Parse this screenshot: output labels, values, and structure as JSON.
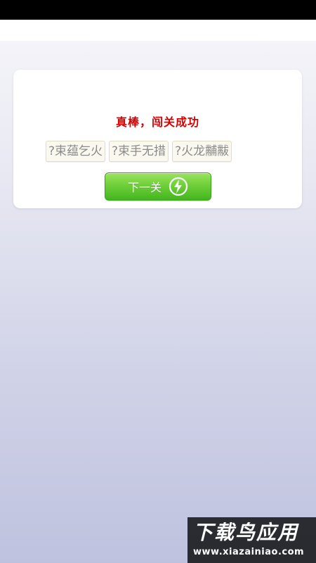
{
  "result": {
    "message": "真棒，闯关成功",
    "idioms": [
      "?束蕴乞火",
      "?束手无措",
      "?火龙黼黻"
    ],
    "next_button_label": "下一关",
    "next_button_icon": "bolt-icon"
  },
  "watermark": {
    "title": "下载鸟应用",
    "url": "www.xiazainiao.com"
  },
  "colors": {
    "message": "#d80000",
    "button_green": "#6fd03a"
  }
}
